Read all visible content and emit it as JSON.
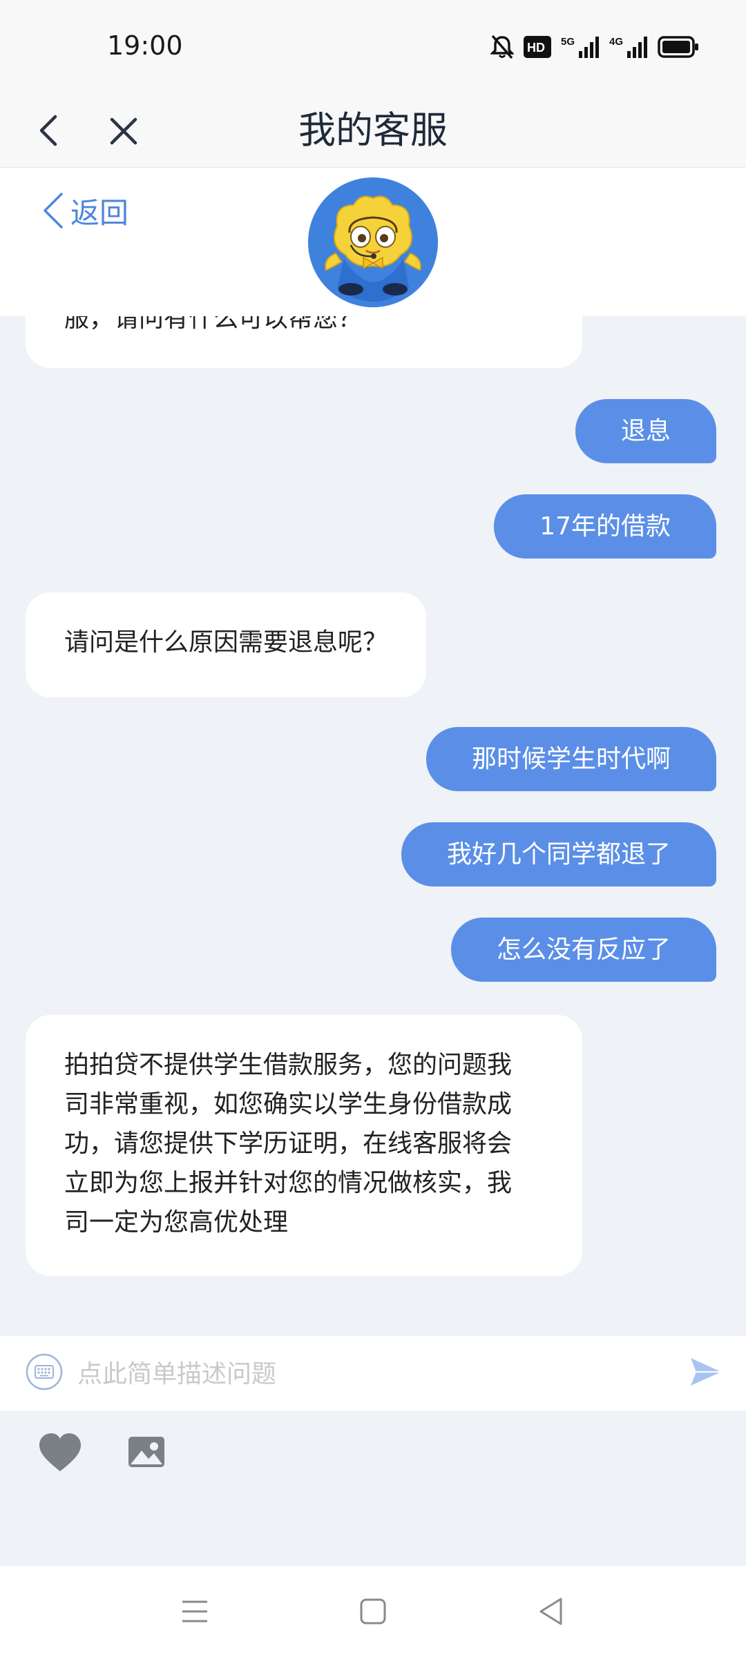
{
  "status_bar": {
    "time": "19:00",
    "icons": [
      "bell-mute-icon",
      "hd-icon",
      "5g-signal-icon",
      "4g-signal-icon",
      "battery-icon"
    ],
    "hd_label": "HD",
    "net1_label": "5G",
    "net2_label": "4G"
  },
  "title_bar": {
    "title": "我的客服",
    "back_icon": "chevron-left-icon",
    "close_icon": "close-icon"
  },
  "service_header": {
    "back_label": "返回",
    "avatar": "customer-service-mascot"
  },
  "chat": {
    "messages": [
      {
        "from": "agent",
        "text": "服，请问有什么可以帮您？"
      },
      {
        "from": "user",
        "text": "退息"
      },
      {
        "from": "user",
        "text": "17年的借款"
      },
      {
        "from": "agent",
        "text": "请问是什么原因需要退息呢？"
      },
      {
        "from": "user",
        "text": "那时候学生时代啊"
      },
      {
        "from": "user",
        "text": "我好几个同学都退了"
      },
      {
        "from": "user",
        "text": "怎么没有反应了"
      },
      {
        "from": "agent",
        "lines": [
          "拍拍贷不提供学生借款服务，您的问题我",
          "司非常重视，如您确实以学生身份借款成",
          "功，请您提供下学历证明，在线客服将会",
          "立即为您上报并针对您的情况做核实，我",
          "司一定为您高优处理"
        ]
      }
    ]
  },
  "input": {
    "placeholder": "点此简单描述问题",
    "value": ""
  },
  "colors": {
    "accent": "#5b8fe7",
    "background": "#eff2f7",
    "link": "#4f86dd"
  }
}
